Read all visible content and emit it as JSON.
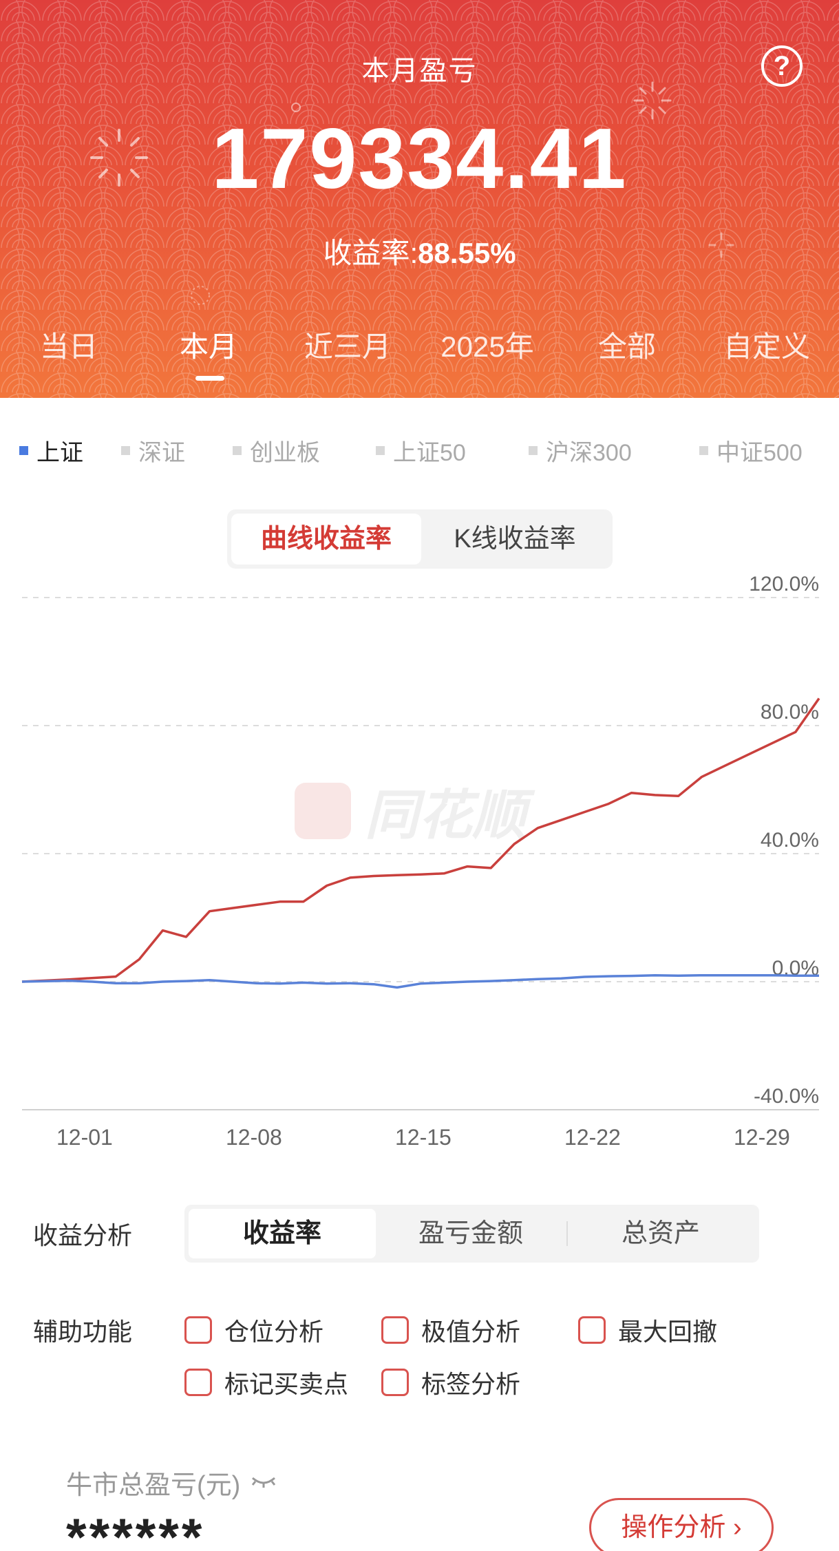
{
  "header": {
    "title": "本月盈亏",
    "amount": "179334.41",
    "rate_label": "收益率:",
    "rate_value": "88.55%",
    "help_icon": "?"
  },
  "period_tabs": [
    {
      "label": "当日",
      "active": false
    },
    {
      "label": "本月",
      "active": true
    },
    {
      "label": "近三月",
      "active": false
    },
    {
      "label": "2025年",
      "active": false
    },
    {
      "label": "全部",
      "active": false
    },
    {
      "label": "自定义",
      "active": false
    }
  ],
  "index_legend": [
    {
      "label": "上证",
      "active": true
    },
    {
      "label": "深证",
      "active": false
    },
    {
      "label": "创业板",
      "active": false
    },
    {
      "label": "上证50",
      "active": false
    },
    {
      "label": "沪深300",
      "active": false
    },
    {
      "label": "中证500",
      "active": false
    }
  ],
  "chart_mode": {
    "options": [
      "曲线收益率",
      "K线收益率"
    ],
    "selected": "曲线收益率"
  },
  "watermark": "同花顺",
  "chart_data": {
    "type": "line",
    "x_ticks": [
      "12-01",
      "12-08",
      "12-15",
      "12-22",
      "12-29"
    ],
    "y_ticks": [
      "120.0%",
      "80.0%",
      "40.0%",
      "0.0%",
      "-40.0%"
    ],
    "ylim": [
      -40,
      120
    ],
    "x_range": [
      0,
      35
    ],
    "series": [
      {
        "color": "#c9403d",
        "points": [
          [
            -2,
            0
          ],
          [
            0,
            0.7
          ],
          [
            2,
            1.6
          ],
          [
            3,
            7
          ],
          [
            4,
            16
          ],
          [
            5,
            14
          ],
          [
            6,
            22
          ],
          [
            7,
            23
          ],
          [
            8,
            24
          ],
          [
            9,
            25
          ],
          [
            10,
            25
          ],
          [
            11,
            30
          ],
          [
            12,
            32.5
          ],
          [
            13,
            33
          ],
          [
            14,
            33.3
          ],
          [
            15,
            33.5
          ],
          [
            16,
            33.8
          ],
          [
            17,
            36
          ],
          [
            18,
            35.5
          ],
          [
            19,
            43
          ],
          [
            20,
            48
          ],
          [
            21,
            50.5
          ],
          [
            22,
            53
          ],
          [
            23,
            55.5
          ],
          [
            24,
            59
          ],
          [
            25,
            58.3
          ],
          [
            26,
            58
          ],
          [
            27,
            64
          ],
          [
            28,
            67.5
          ],
          [
            29,
            71
          ],
          [
            30,
            74.5
          ],
          [
            31,
            78
          ],
          [
            32,
            88.5
          ]
        ]
      },
      {
        "color": "#5a82d8",
        "points": [
          [
            -2,
            0
          ],
          [
            0,
            0.3
          ],
          [
            1,
            0
          ],
          [
            2,
            -0.5
          ],
          [
            3,
            -0.5
          ],
          [
            4,
            0
          ],
          [
            5,
            0.2
          ],
          [
            6,
            0.5
          ],
          [
            7,
            0
          ],
          [
            8,
            -0.5
          ],
          [
            9,
            -0.6
          ],
          [
            10,
            -0.3
          ],
          [
            11,
            -0.6
          ],
          [
            12,
            -0.5
          ],
          [
            13,
            -0.8
          ],
          [
            14,
            -1.8
          ],
          [
            15,
            -0.6
          ],
          [
            16,
            -0.3
          ],
          [
            17,
            0
          ],
          [
            18,
            0.2
          ],
          [
            19,
            0.5
          ],
          [
            20,
            0.8
          ],
          [
            21,
            1
          ],
          [
            22,
            1.5
          ],
          [
            23,
            1.7
          ],
          [
            24,
            1.8
          ],
          [
            25,
            2
          ],
          [
            26,
            1.9
          ],
          [
            27,
            2
          ],
          [
            28,
            2
          ],
          [
            29,
            2
          ],
          [
            30,
            2
          ],
          [
            31,
            1.9
          ],
          [
            32,
            1.9
          ]
        ]
      }
    ]
  },
  "analysis": {
    "label": "收益分析",
    "options": [
      "收益率",
      "盈亏金额",
      "总资产"
    ],
    "selected": "收益率"
  },
  "aux": {
    "label": "辅助功能",
    "options": [
      "仓位分析",
      "极值分析",
      "最大回撤",
      "标记买卖点",
      "标签分析"
    ]
  },
  "bull": {
    "label": "牛市总盈亏(元)",
    "value": "******",
    "button": "操作分析 ›"
  }
}
